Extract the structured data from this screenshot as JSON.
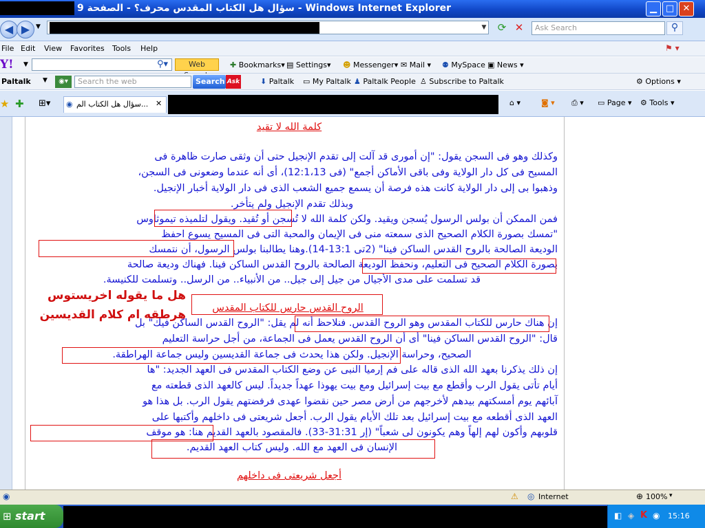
{
  "window": {
    "title": "سؤال هل الكتاب المقدس محرف؟ - الصفحة 9 - Windows Internet Explorer",
    "minimize_icon": "minimize-icon",
    "maximize_icon": "maximize-icon",
    "close_icon": "close-icon"
  },
  "address_bar": {
    "search_placeholder": "Ask Search"
  },
  "menu": {
    "items": [
      "File",
      "Edit",
      "View",
      "Favorites",
      "Tools",
      "Help"
    ]
  },
  "yahoo_toolbar": {
    "logo": "Y!",
    "web_search": "Web Search",
    "bookmarks": "Bookmarks",
    "settings": "Settings",
    "messenger": "Messenger",
    "mail": "Mail",
    "myspace": "MySpace",
    "news": "News"
  },
  "paltalk_toolbar": {
    "brand": "Paltalk",
    "search_placeholder": "Search the web",
    "search_button": "Search",
    "ask_logo": "Ask",
    "paltalk_link": "Paltalk",
    "my_paltalk": "My Paltalk",
    "paltalk_people": "Paltalk People",
    "subscribe": "Subscribe to Paltalk",
    "options": "Options"
  },
  "tabs": {
    "active_tab": "سؤال هل الكتاب الم...",
    "page_menu": "Page",
    "tools_menu": "Tools"
  },
  "content": {
    "heading_top": "كلمة الله لا تقيد",
    "lines": [
      "وكذلك وهو فى السجن يقول: \"إن أمورى قد آلت إلى تقدم الإنجيل حتى أن وثقى صارت ظاهرة فى",
      "المسيح فى كل دار الولاية وفى باقى الأماكن أجمع\" (فى 12:1،13)، أى أنه عندما وضعونى فى السجن،",
      "وذهبوا بى إلى دار الولاية كانت هذه فرصة أن يسمع جميع الشعب الذى فى دار الولاية أخبار الإنجيل.",
      "وبذلك تقدم الإنجيل ولم يتأخر.",
      "فمن الممكن أن بولس الرسول يُسجن ويقيد. ولكن كلمة الله لا تُسجن أو تُقيد. ويقول لتلميذه تيموثاوس",
      "\"تمسك بصورة الكلام الصحيح الذى سمعته منى فى الإيمان والمحبة التى فى المسيح يسوع احفظ",
      "الوديعة الصالحة بالروح القدس الساكن فينا\" (2تى 13:1-14).وهنا يطالبنا بولس الرسول، أن نتمسك",
      "بصورة الكلام الصحيح فى التعليم، ونحفظ الوديعة الصالحة بالروح القدس الساكن فينا. فهناك وديعة صالحة",
      "قد تسلمت على مدى الأجيال من جيل إلى جيل.. من الأنبياء.. من الرسل.. وتسلمت للكنيسة.",
      "إن هناك حارس للكتاب المقدس وهو الروح القدس. فنلاحظ أنه لم يقل: \"الروح القدس الساكن فيك\" بل",
      "قال: \"الروح القدس الساكن فينا\" أى أن الروح القدس يعمل فى الجماعة، من أجل حراسة التعليم",
      "الصحيح، وحراسة الإنجيل. ولكن هذا يحدث فى جماعة القديسين وليس جماعة الهراطقة.",
      "إن ذلك يذكرنا بعهد الله الذى قاله على فم إرميا النبى عن وضع الكتاب المقدس فى العهد الجديد: \"ها",
      "أيام تأتى يقول الرب وأقطع مع بيت إسرائيل ومع بيت يهوذا عهداً جديداً. ليس كالعهد الذى قطعته مع",
      "آبائهم يوم أمسكتهم بيدهم لأخرجهم من أرض مصر حين نقضوا عهدى فرفضتهم يقول الرب. بل هذا هو",
      "العهد الذى أقطعه مع بيت إسرائيل بعد تلك الأيام يقول الرب. أجعل شريعتى فى داخلهم وأكتبها على",
      "قلوبهم وأكون لهم إلهاً وهم يكونون لى شعباً\" (إر 31:31-33). فالمقصود بالعهد القديم هنا: هو موقف",
      "الإنسان فى العهد مع الله. وليس كتاب العهد القديم."
    ],
    "mid_heading": "الروح القدس حارس للكتاب المقدس",
    "side_note_1": "هل ما يقوله اخريستوس",
    "side_note_2": "هرطقه ام كلام القديسين",
    "heading_bottom": "أجعل شريعتى فى داخلهم"
  },
  "status_bar": {
    "zone": "Internet",
    "zoom": "100%"
  },
  "taskbar": {
    "start": "start",
    "clock": "15:16"
  },
  "colors": {
    "title_bar": "#1148c8",
    "arabic_text": "#1414d2",
    "highlight_red": "#e01010",
    "taskbar": "#2456c7"
  }
}
